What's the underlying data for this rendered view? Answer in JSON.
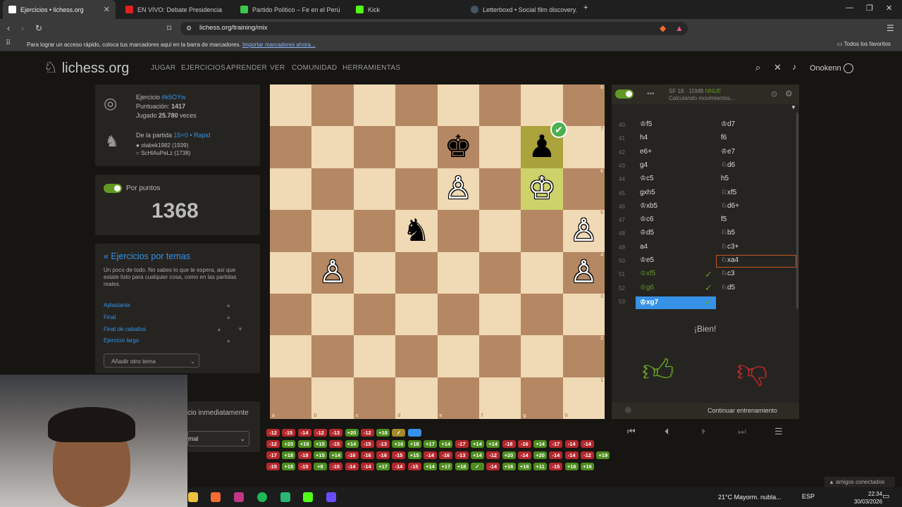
{
  "browser": {
    "tabs": [
      {
        "title": "Ejercicios • lichess.org",
        "active": true
      },
      {
        "title": "EN VIVO: Debate Presidencia"
      },
      {
        "title": "Partido Político – Fe en el Perú"
      },
      {
        "title": "Kick"
      },
      {
        "title": "Letterboxd • Social film discovery."
      }
    ],
    "url": "lichess.org/training/mix",
    "bookmarks_hint": "Para lograr un acceso rápido, coloca tus marcadores aquí en la barra de marcadores.",
    "bookmarks_import": "Importar marcadores ahora...",
    "bookmarks_folder": "Todos los favoritos"
  },
  "site": {
    "logo": "lichess.org",
    "nav": [
      "JUGAR",
      "EJERCICIOS",
      "APRENDER",
      "VER",
      "COMUNIDAD",
      "HERRAMIENTAS"
    ],
    "username": "Onokenn"
  },
  "puzzle": {
    "label": "Ejercicio",
    "id": "#k5OYw",
    "rating_label": "Puntuación:",
    "rating": "1417",
    "played_label": "Jugado",
    "played": "25.780",
    "played_suffix": "veces",
    "game_label": "De la partida",
    "game_type": "15+0 • Rapid",
    "player_white": "otabek1982 (1939)",
    "player_black": "ScHlAuPeLz (1738)"
  },
  "score": {
    "label": "Por puntos",
    "value": "1368"
  },
  "themes": {
    "title": "« Ejercicios por temas",
    "description": "Un poco de todo. No sabes lo que te espera, así que estate listo para cualquier cosa, como en las partidas reales.",
    "items": [
      "Aplastante",
      "Final",
      "Final de caballos",
      "Ejercicio largo"
    ],
    "add_select": "Añadir otro tema"
  },
  "next": {
    "label": "cio inmediatamente",
    "select": "mal"
  },
  "engine": {
    "title": "SF 18 · 15MB",
    "badge": "NNUE",
    "status": "Calculando movimientos..."
  },
  "moves": [
    {
      "n": "40",
      "w": "♔f5",
      "b": "♔d7"
    },
    {
      "n": "41",
      "w": "h4",
      "b": "f6"
    },
    {
      "n": "42",
      "w": "e6+",
      "b": "♔e7"
    },
    {
      "n": "43",
      "w": "g4",
      "b": "♘d6"
    },
    {
      "n": "44",
      "w": "♔c5",
      "b": "h5"
    },
    {
      "n": "45",
      "w": "gxh5",
      "b": "♘xf5"
    },
    {
      "n": "46",
      "w": "♔xb5",
      "b": "♘d6+"
    },
    {
      "n": "47",
      "w": "♔c6",
      "b": "f5"
    },
    {
      "n": "48",
      "w": "♔d5",
      "b": "♘b5"
    },
    {
      "n": "49",
      "w": "a4",
      "b": "♘c3+"
    },
    {
      "n": "50",
      "w": "♔e5",
      "b": "♘xa4"
    },
    {
      "n": "51",
      "w": "♔xf5",
      "b": "♘c3"
    },
    {
      "n": "52",
      "w": "♔g6",
      "b": "♘d5"
    },
    {
      "n": "53",
      "w": "♔xg7",
      "b": ""
    }
  ],
  "feedback": {
    "text": "¡Bien!",
    "continue": "Continuar entrenamiento"
  },
  "board": {
    "files": [
      "a",
      "b",
      "c",
      "d",
      "e",
      "f",
      "g",
      "h"
    ],
    "ranks": [
      "8",
      "7",
      "6",
      "5",
      "4",
      "3",
      "2",
      "1"
    ],
    "highlight": [
      "g7",
      "g6"
    ],
    "pieces": {
      "e7": "♚",
      "g7": "♟",
      "e6": "♙",
      "g6": "♔",
      "d5": "♞",
      "h5": "♙",
      "b4": "♙",
      "h4": "♙"
    }
  },
  "chips": [
    [
      "-12",
      "-15",
      "-14",
      "-12",
      "-13",
      "+20",
      "-12",
      "+18",
      "✓",
      "•"
    ],
    [
      "-12",
      "+20",
      "+19",
      "+15",
      "-15",
      "+14",
      "-15",
      "-13",
      "+16",
      "+18",
      "+17",
      "+14",
      "-17",
      "+14",
      "+14",
      "-18",
      "-16",
      "+14",
      "-17",
      "-14",
      "-14"
    ],
    [
      "-17",
      "+18",
      "-18",
      "+15",
      "+14",
      "-16",
      "-16",
      "-16",
      "-15",
      "+15",
      "-14",
      "-16",
      "-13",
      "+14",
      "-12",
      "+20",
      "-14",
      "+20",
      "-14",
      "-14",
      "-12",
      "+19"
    ],
    [
      "-15",
      "+18",
      "-15",
      "+8",
      "-15",
      "-14",
      "-14",
      "+17",
      "-14",
      "-15",
      "+14",
      "+17",
      "+18",
      "✓",
      "-14",
      "+16",
      "+16",
      "+11",
      "-15",
      "+16",
      "+16"
    ]
  ],
  "system": {
    "weather": "21°C  Mayorm. nubla...",
    "lang": "ESP",
    "time": "22:34",
    "date": "30/03/2026",
    "friends": "amigos conectados"
  },
  "colors": {
    "accent": "#3692e7",
    "good": "#629924",
    "bad": "#b3282c"
  }
}
